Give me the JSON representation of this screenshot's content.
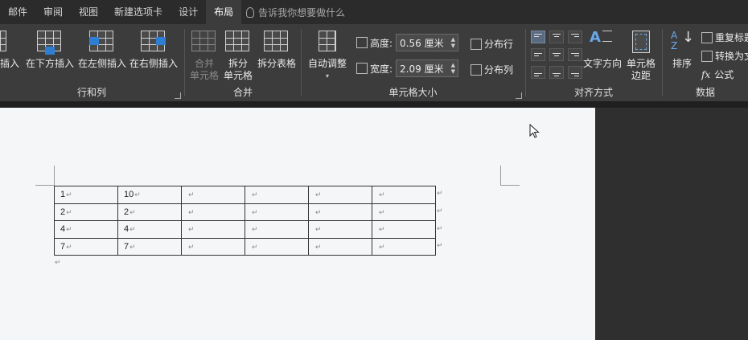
{
  "tabs": [
    {
      "label": "邮件"
    },
    {
      "label": "审阅"
    },
    {
      "label": "视图"
    },
    {
      "label": "新建选项卡"
    },
    {
      "label": "设计"
    },
    {
      "label": "布局",
      "active": true
    }
  ],
  "tell_me": "告诉我你想要做什么",
  "groups": {
    "rows_cols": {
      "label": "行和列",
      "buttons": [
        "插入",
        "在下方插入",
        "在左侧插入",
        "在右侧插入"
      ]
    },
    "merge": {
      "label": "合并",
      "merge_cells": [
        "合并",
        "单元格"
      ],
      "split_cells": [
        "拆分",
        "单元格"
      ],
      "split_table": "拆分表格"
    },
    "cell_size": {
      "label": "单元格大小",
      "autofit": "自动调整",
      "height_label": "高度:",
      "height_value": "0.56 厘米",
      "width_label": "宽度:",
      "width_value": "2.09 厘米",
      "distribute_rows": "分布行",
      "distribute_cols": "分布列"
    },
    "alignment": {
      "label": "对齐方式",
      "text_direction": "文字方向",
      "cell_margins": [
        "单元格",
        "边距"
      ]
    },
    "data": {
      "label": "数据",
      "sort": "排序",
      "repeat_header": "重复标题",
      "convert": "转换为文",
      "formula": "公式"
    }
  },
  "table": {
    "rows": [
      [
        "1",
        "10",
        "",
        "",
        "",
        ""
      ],
      [
        "2",
        "2",
        "",
        "",
        "",
        ""
      ],
      [
        "4",
        "4",
        "",
        "",
        "",
        ""
      ],
      [
        "7",
        "7",
        "",
        "",
        "",
        ""
      ]
    ]
  },
  "paragraph_mark": "↵"
}
